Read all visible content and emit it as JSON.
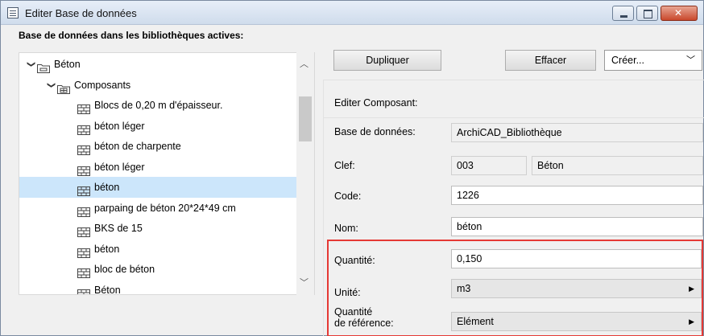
{
  "window": {
    "title": "Editer Base de données"
  },
  "library": {
    "label": "Base de données dans les bibliothèques actives:",
    "tree": [
      {
        "label": "Béton",
        "level": 0,
        "expanded": true,
        "icon": "database-folder-icon",
        "selected": false
      },
      {
        "label": "Composants",
        "level": 1,
        "expanded": true,
        "icon": "components-folder-icon",
        "selected": false
      },
      {
        "label": "Blocs de 0,20 m d'épaisseur.",
        "level": 2,
        "icon": "brick-icon",
        "selected": false
      },
      {
        "label": "béton léger",
        "level": 2,
        "icon": "brick-icon",
        "selected": false
      },
      {
        "label": "béton de charpente",
        "level": 2,
        "icon": "brick-icon",
        "selected": false
      },
      {
        "label": "béton léger",
        "level": 2,
        "icon": "brick-icon",
        "selected": false
      },
      {
        "label": "béton",
        "level": 2,
        "icon": "brick-icon",
        "selected": true
      },
      {
        "label": "parpaing de béton 20*24*49 cm",
        "level": 2,
        "icon": "brick-icon",
        "selected": false
      },
      {
        "label": "BKS de 15",
        "level": 2,
        "icon": "brick-icon",
        "selected": false
      },
      {
        "label": "béton",
        "level": 2,
        "icon": "brick-icon",
        "selected": false
      },
      {
        "label": "bloc de béton",
        "level": 2,
        "icon": "brick-icon",
        "selected": false
      },
      {
        "label": "Béton",
        "level": 2,
        "icon": "brick-icon",
        "selected": false
      }
    ]
  },
  "toolbar": {
    "duplicate_label": "Dupliquer",
    "delete_label": "Effacer",
    "create_label": "Créer..."
  },
  "editor": {
    "section_title": "Editer Composant:",
    "database_label": "Base de données:",
    "database_value": "ArchiCAD_Bibliothèque",
    "key_label": "Clef:",
    "key_code": "003",
    "key_name": "Béton",
    "code_label": "Code:",
    "code_value": "1226",
    "name_label": "Nom:",
    "name_value": "béton",
    "quantity_label": "Quantité:",
    "quantity_value": "0,150",
    "unit_label": "Unité:",
    "unit_value": "m3",
    "ref_quantity_label_1": "Quantité",
    "ref_quantity_label_2": "de référence:",
    "ref_quantity_value": "Elément"
  },
  "colors": {
    "selection": "#cce6fb",
    "highlight_border": "#e53935"
  }
}
